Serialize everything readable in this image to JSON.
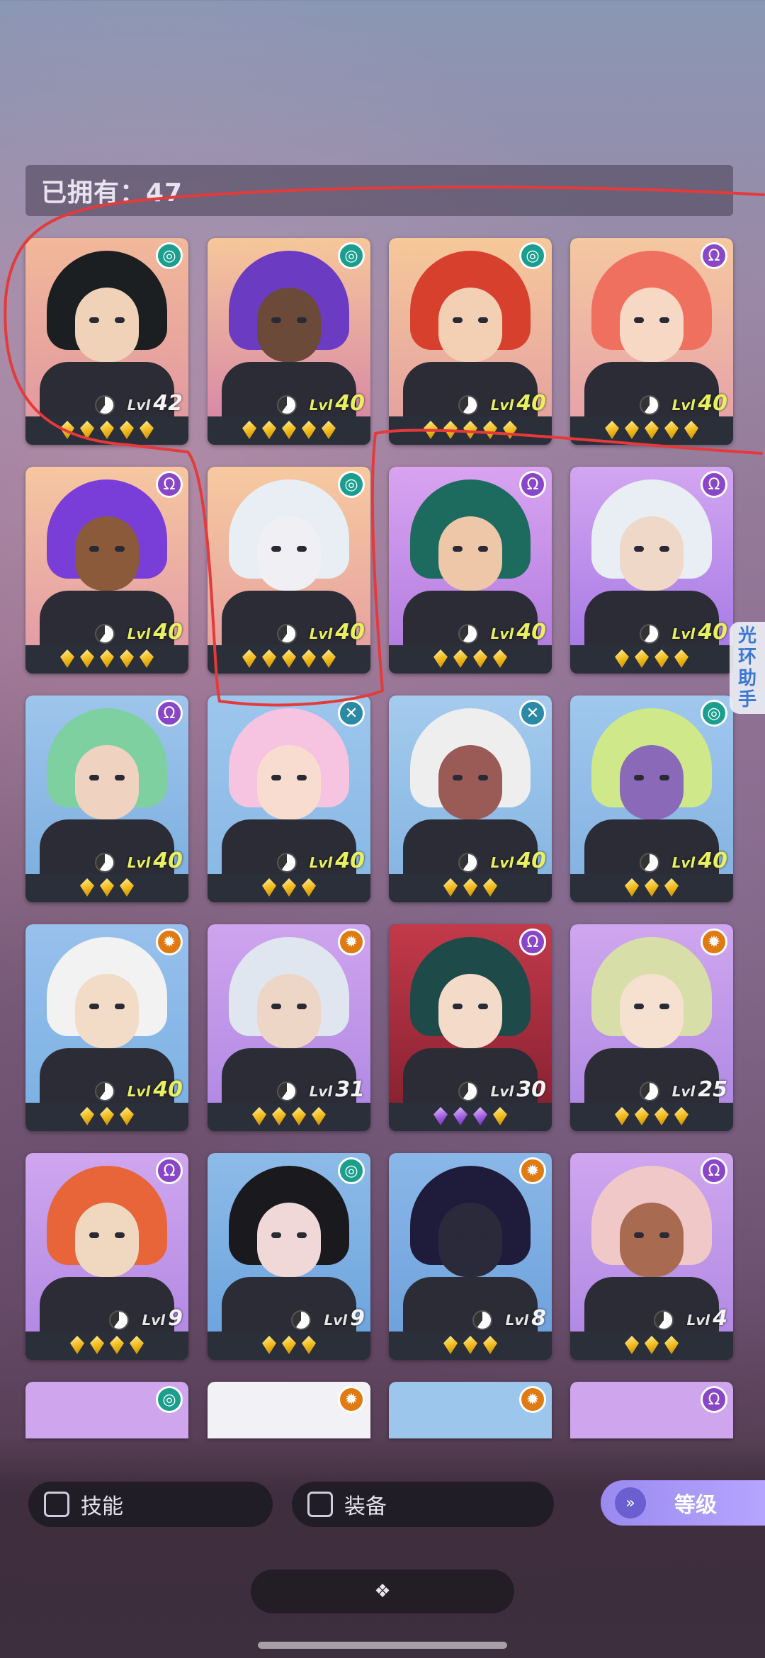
{
  "header": {
    "owned_label": "已拥有：47"
  },
  "side_tab": {
    "chars": [
      "光",
      "环",
      "助",
      "手"
    ]
  },
  "filters": {
    "skill_label": "技能",
    "equip_label": "装备",
    "sort_label": "等级"
  },
  "level_prefix": "Lvl",
  "heroes": [
    {
      "level": "42",
      "stars": 5,
      "badge": "teal"
    },
    {
      "level": "40",
      "stars": 5,
      "badge": "teal"
    },
    {
      "level": "40",
      "stars": 5,
      "badge": "teal"
    },
    {
      "level": "40",
      "stars": 5,
      "badge": "purple"
    },
    {
      "level": "40",
      "stars": 5,
      "badge": "purple"
    },
    {
      "level": "40",
      "stars": 5,
      "badge": "teal"
    },
    {
      "level": "40",
      "stars": 4,
      "badge": "purple"
    },
    {
      "level": "40",
      "stars": 4,
      "badge": "purple"
    },
    {
      "level": "40",
      "stars": 3,
      "badge": "purple"
    },
    {
      "level": "40",
      "stars": 3,
      "badge": "x"
    },
    {
      "level": "40",
      "stars": 3,
      "badge": "x"
    },
    {
      "level": "40",
      "stars": 3,
      "badge": "teal"
    },
    {
      "level": "40",
      "stars": 3,
      "badge": "orange"
    },
    {
      "level": "31",
      "stars": 4,
      "badge": "orange"
    },
    {
      "level": "30",
      "stars": 4,
      "badge": "purple",
      "purple_gems": 3
    },
    {
      "level": "25",
      "stars": 4,
      "badge": "orange"
    },
    {
      "level": "9",
      "stars": 4,
      "badge": "purple"
    },
    {
      "level": "9",
      "stars": 3,
      "badge": "teal"
    },
    {
      "level": "8",
      "stars": 3,
      "badge": "orange"
    },
    {
      "level": "4",
      "stars": 3,
      "badge": "purple"
    }
  ],
  "partial_row_badges": [
    "teal",
    "orange",
    "orange",
    "purple"
  ],
  "icons": {
    "teal": "swirl-icon",
    "purple": "omega-icon",
    "orange": "sun-icon",
    "x": "cross-icon",
    "sort": "double-chevron-down-icon",
    "dock": "diamond-cluster-icon"
  }
}
